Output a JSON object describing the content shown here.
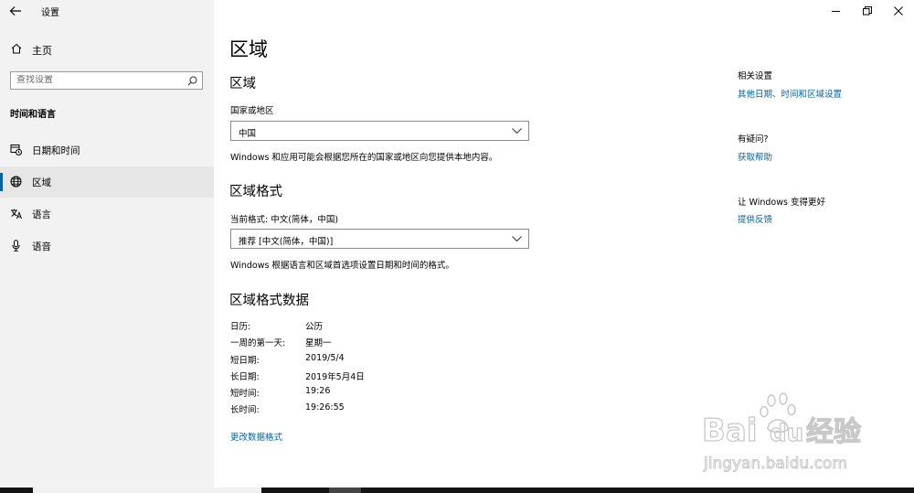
{
  "window": {
    "title": "设置",
    "home_label": "主页",
    "search_placeholder": "查找设置",
    "section_heading": "时间和语言"
  },
  "sidebar": {
    "items": [
      {
        "label": "日期和时间",
        "icon": "calendar-clock-icon"
      },
      {
        "label": "区域",
        "icon": "globe-icon",
        "active": true
      },
      {
        "label": "语言",
        "icon": "language-icon"
      },
      {
        "label": "语音",
        "icon": "microphone-icon"
      }
    ]
  },
  "main": {
    "page_title": "区域",
    "region": {
      "heading": "区域",
      "field_label": "国家或地区",
      "selected": "中国",
      "description": "Windows 和应用可能会根据您所在的国家或地区向您提供本地内容。"
    },
    "format": {
      "heading": "区域格式",
      "current_label": "当前格式: 中文(简体，中国)",
      "selected": "推荐 [中文(简体，中国)]",
      "description": "Windows 根据语言和区域首选项设置日期和时间的格式。"
    },
    "data": {
      "heading": "区域格式数据",
      "rows": [
        {
          "label": "日历:",
          "value": "公历"
        },
        {
          "label": "一周的第一天:",
          "value": "星期一"
        },
        {
          "label": "短日期:",
          "value": "2019/5/4"
        },
        {
          "label": "长日期:",
          "value": "2019年5月4日"
        },
        {
          "label": "短时间:",
          "value": "19:26"
        },
        {
          "label": "长时间:",
          "value": "19:26:55"
        }
      ],
      "change_link": "更改数据格式"
    }
  },
  "right_panel": {
    "related_heading": "相关设置",
    "related_link": "其他日期、时间和区域设置",
    "help_heading": "有疑问?",
    "help_link": "获取帮助",
    "feedback_heading": "让 Windows 变得更好",
    "feedback_link": "提供反馈"
  },
  "watermark": {
    "brand": "Bai",
    "brand2": "du",
    "cn": "经验",
    "url": "jingyan.baidu.com"
  },
  "colors": {
    "accent": "#0063b1",
    "sidebar_bg": "#f2f2f2",
    "active_bg": "#e6e6e6"
  }
}
